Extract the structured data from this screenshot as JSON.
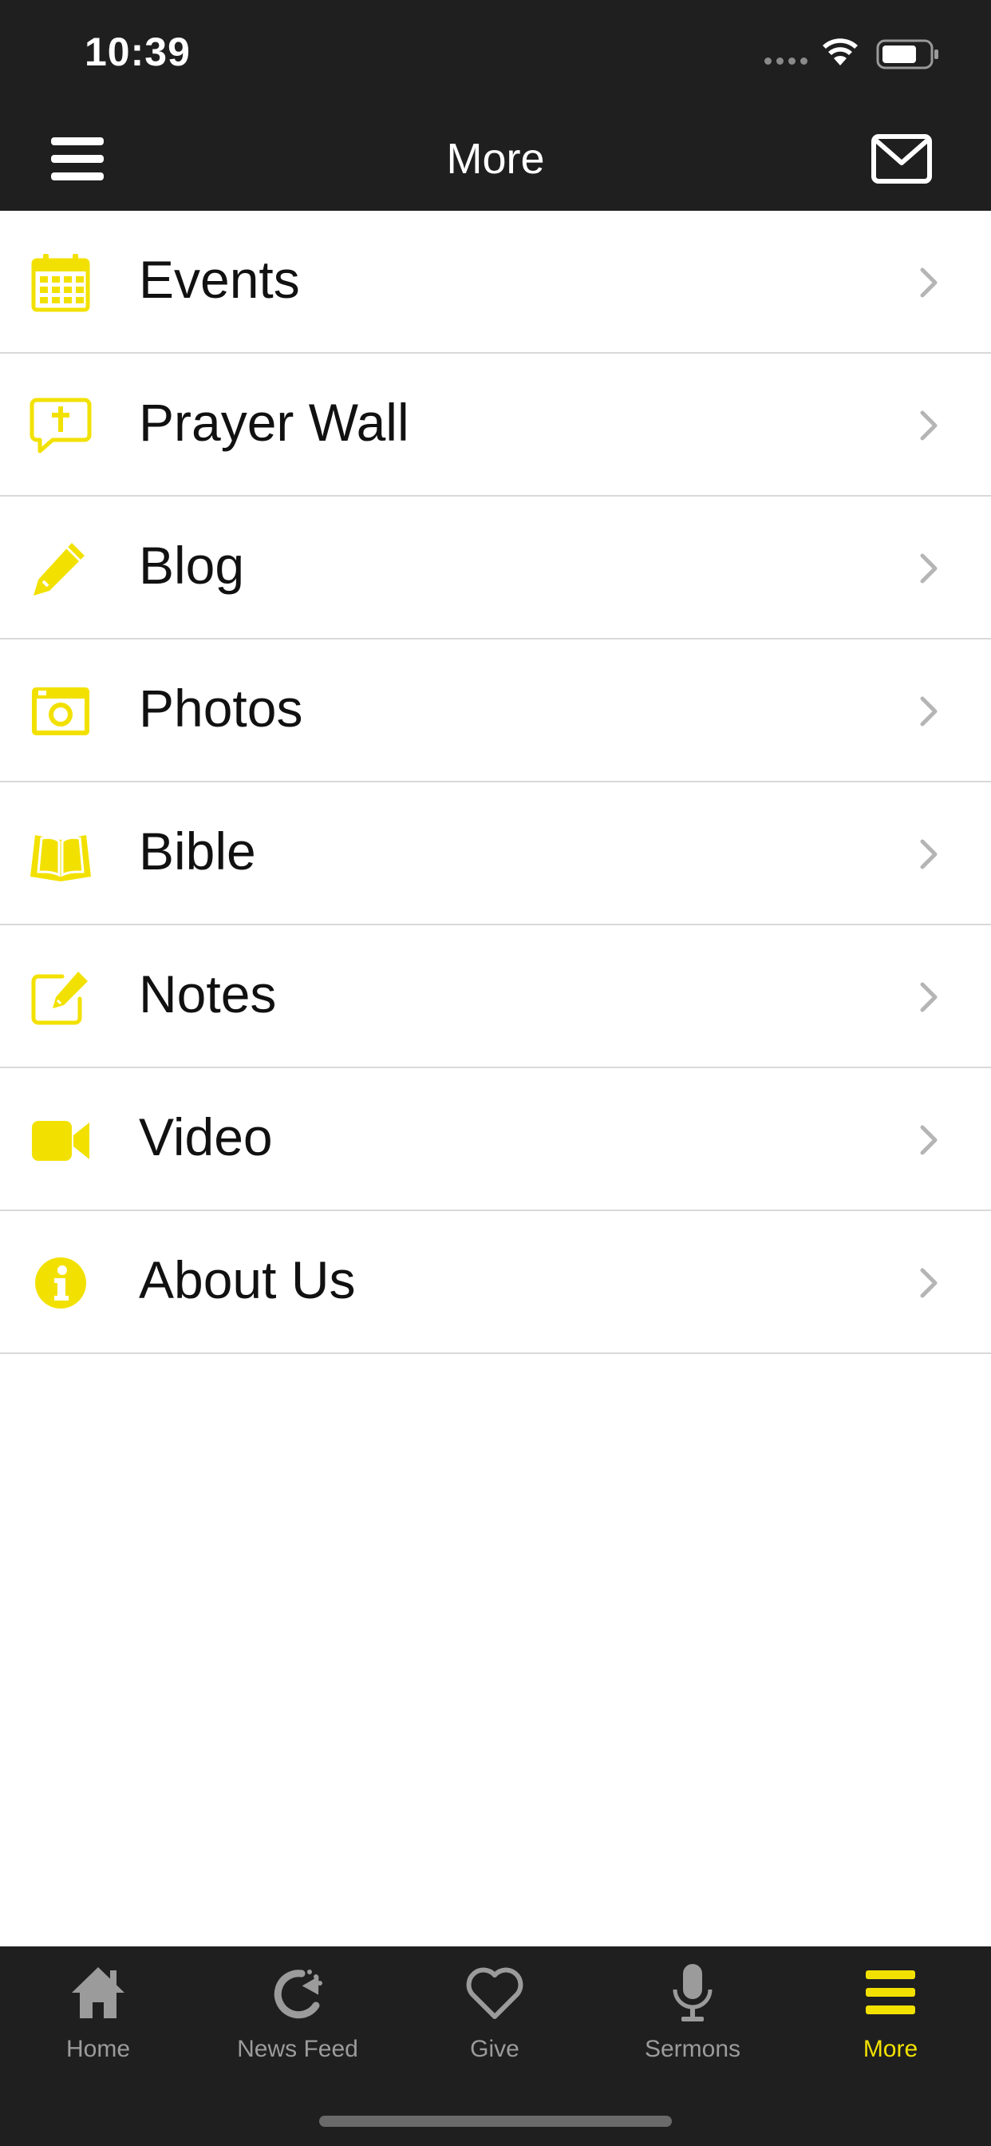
{
  "status": {
    "time": "10:39"
  },
  "nav": {
    "title": "More"
  },
  "menu": [
    {
      "label": "Events",
      "icon": "calendar-icon"
    },
    {
      "label": "Prayer Wall",
      "icon": "prayer-bubble-icon"
    },
    {
      "label": "Blog",
      "icon": "pencil-icon"
    },
    {
      "label": "Photos",
      "icon": "camera-icon"
    },
    {
      "label": "Bible",
      "icon": "open-book-icon"
    },
    {
      "label": "Notes",
      "icon": "edit-note-icon"
    },
    {
      "label": "Video",
      "icon": "video-camera-icon"
    },
    {
      "label": "About Us",
      "icon": "info-icon"
    }
  ],
  "tabs": [
    {
      "label": "Home",
      "icon": "home-icon"
    },
    {
      "label": "News Feed",
      "icon": "refresh-icon"
    },
    {
      "label": "Give",
      "icon": "heart-icon"
    },
    {
      "label": "Sermons",
      "icon": "microphone-icon"
    },
    {
      "label": "More",
      "icon": "hamburger-icon"
    }
  ],
  "colors": {
    "accent": "#f2e100",
    "bar": "#1f1f1f",
    "inactive": "#9b9b9b"
  }
}
